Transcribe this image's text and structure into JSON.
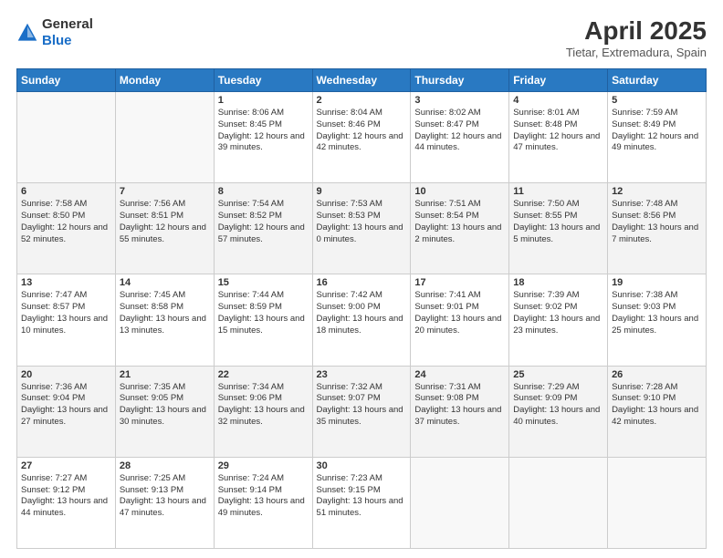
{
  "header": {
    "logo_line1": "General",
    "logo_line2": "Blue",
    "month_year": "April 2025",
    "location": "Tietar, Extremadura, Spain"
  },
  "days_of_week": [
    "Sunday",
    "Monday",
    "Tuesday",
    "Wednesday",
    "Thursday",
    "Friday",
    "Saturday"
  ],
  "weeks": [
    [
      {
        "num": "",
        "info": ""
      },
      {
        "num": "",
        "info": ""
      },
      {
        "num": "1",
        "info": "Sunrise: 8:06 AM\nSunset: 8:45 PM\nDaylight: 12 hours and 39 minutes."
      },
      {
        "num": "2",
        "info": "Sunrise: 8:04 AM\nSunset: 8:46 PM\nDaylight: 12 hours and 42 minutes."
      },
      {
        "num": "3",
        "info": "Sunrise: 8:02 AM\nSunset: 8:47 PM\nDaylight: 12 hours and 44 minutes."
      },
      {
        "num": "4",
        "info": "Sunrise: 8:01 AM\nSunset: 8:48 PM\nDaylight: 12 hours and 47 minutes."
      },
      {
        "num": "5",
        "info": "Sunrise: 7:59 AM\nSunset: 8:49 PM\nDaylight: 12 hours and 49 minutes."
      }
    ],
    [
      {
        "num": "6",
        "info": "Sunrise: 7:58 AM\nSunset: 8:50 PM\nDaylight: 12 hours and 52 minutes."
      },
      {
        "num": "7",
        "info": "Sunrise: 7:56 AM\nSunset: 8:51 PM\nDaylight: 12 hours and 55 minutes."
      },
      {
        "num": "8",
        "info": "Sunrise: 7:54 AM\nSunset: 8:52 PM\nDaylight: 12 hours and 57 minutes."
      },
      {
        "num": "9",
        "info": "Sunrise: 7:53 AM\nSunset: 8:53 PM\nDaylight: 13 hours and 0 minutes."
      },
      {
        "num": "10",
        "info": "Sunrise: 7:51 AM\nSunset: 8:54 PM\nDaylight: 13 hours and 2 minutes."
      },
      {
        "num": "11",
        "info": "Sunrise: 7:50 AM\nSunset: 8:55 PM\nDaylight: 13 hours and 5 minutes."
      },
      {
        "num": "12",
        "info": "Sunrise: 7:48 AM\nSunset: 8:56 PM\nDaylight: 13 hours and 7 minutes."
      }
    ],
    [
      {
        "num": "13",
        "info": "Sunrise: 7:47 AM\nSunset: 8:57 PM\nDaylight: 13 hours and 10 minutes."
      },
      {
        "num": "14",
        "info": "Sunrise: 7:45 AM\nSunset: 8:58 PM\nDaylight: 13 hours and 13 minutes."
      },
      {
        "num": "15",
        "info": "Sunrise: 7:44 AM\nSunset: 8:59 PM\nDaylight: 13 hours and 15 minutes."
      },
      {
        "num": "16",
        "info": "Sunrise: 7:42 AM\nSunset: 9:00 PM\nDaylight: 13 hours and 18 minutes."
      },
      {
        "num": "17",
        "info": "Sunrise: 7:41 AM\nSunset: 9:01 PM\nDaylight: 13 hours and 20 minutes."
      },
      {
        "num": "18",
        "info": "Sunrise: 7:39 AM\nSunset: 9:02 PM\nDaylight: 13 hours and 23 minutes."
      },
      {
        "num": "19",
        "info": "Sunrise: 7:38 AM\nSunset: 9:03 PM\nDaylight: 13 hours and 25 minutes."
      }
    ],
    [
      {
        "num": "20",
        "info": "Sunrise: 7:36 AM\nSunset: 9:04 PM\nDaylight: 13 hours and 27 minutes."
      },
      {
        "num": "21",
        "info": "Sunrise: 7:35 AM\nSunset: 9:05 PM\nDaylight: 13 hours and 30 minutes."
      },
      {
        "num": "22",
        "info": "Sunrise: 7:34 AM\nSunset: 9:06 PM\nDaylight: 13 hours and 32 minutes."
      },
      {
        "num": "23",
        "info": "Sunrise: 7:32 AM\nSunset: 9:07 PM\nDaylight: 13 hours and 35 minutes."
      },
      {
        "num": "24",
        "info": "Sunrise: 7:31 AM\nSunset: 9:08 PM\nDaylight: 13 hours and 37 minutes."
      },
      {
        "num": "25",
        "info": "Sunrise: 7:29 AM\nSunset: 9:09 PM\nDaylight: 13 hours and 40 minutes."
      },
      {
        "num": "26",
        "info": "Sunrise: 7:28 AM\nSunset: 9:10 PM\nDaylight: 13 hours and 42 minutes."
      }
    ],
    [
      {
        "num": "27",
        "info": "Sunrise: 7:27 AM\nSunset: 9:12 PM\nDaylight: 13 hours and 44 minutes."
      },
      {
        "num": "28",
        "info": "Sunrise: 7:25 AM\nSunset: 9:13 PM\nDaylight: 13 hours and 47 minutes."
      },
      {
        "num": "29",
        "info": "Sunrise: 7:24 AM\nSunset: 9:14 PM\nDaylight: 13 hours and 49 minutes."
      },
      {
        "num": "30",
        "info": "Sunrise: 7:23 AM\nSunset: 9:15 PM\nDaylight: 13 hours and 51 minutes."
      },
      {
        "num": "",
        "info": ""
      },
      {
        "num": "",
        "info": ""
      },
      {
        "num": "",
        "info": ""
      }
    ]
  ]
}
